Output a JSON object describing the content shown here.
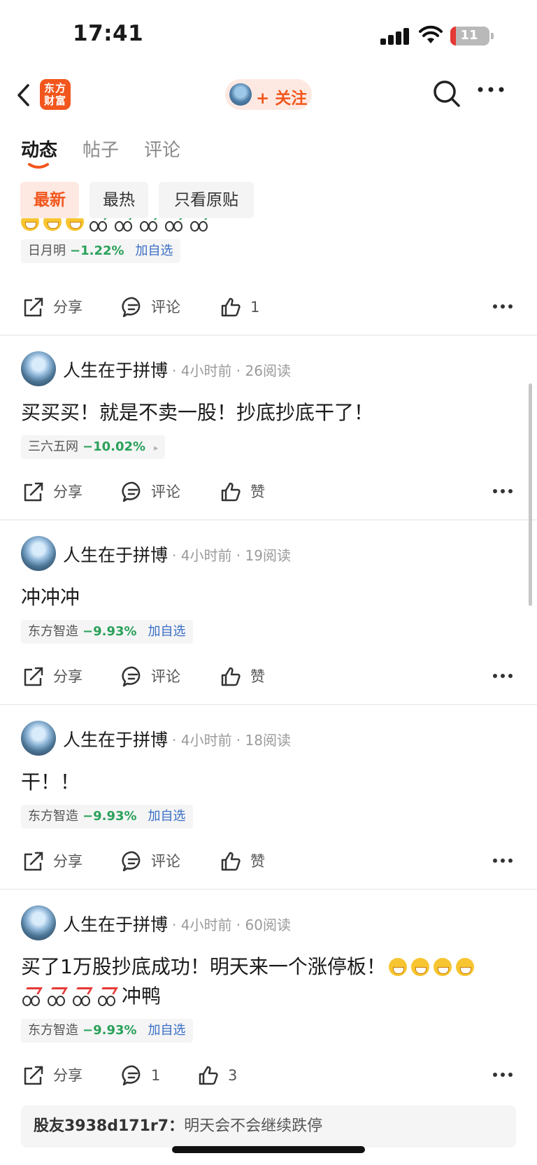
{
  "status_bar": {
    "time": "17:41",
    "battery": "11"
  },
  "header": {
    "logo_line1": "东方",
    "logo_line2": "财富",
    "follow_label": "+ 关注"
  },
  "tabs": [
    {
      "label": "动态",
      "active": true
    },
    {
      "label": "帖子",
      "active": false
    },
    {
      "label": "评论",
      "active": false
    }
  ],
  "filters": [
    {
      "label": "最新",
      "active": true
    },
    {
      "label": "最热",
      "active": false
    },
    {
      "label": "只看原贴",
      "active": false
    }
  ],
  "top_post": {
    "stock": {
      "name": "日月明",
      "change": "−1.22%",
      "action": "加自选"
    },
    "actions": {
      "share": "分享",
      "comment": "评论",
      "like": "1"
    }
  },
  "posts": [
    {
      "author": "人生在于拼博",
      "time": "4小时前",
      "reads": "26阅读",
      "content": "买买买！就是不卖一股！抄底抄底干了！",
      "stock": {
        "name": "三六五网",
        "change": "−10.02%",
        "action": "▸"
      },
      "actions": {
        "share": "分享",
        "comment": "评论",
        "like": "赞"
      }
    },
    {
      "author": "人生在于拼博",
      "time": "4小时前",
      "reads": "19阅读",
      "content": "冲冲冲",
      "stock": {
        "name": "东方智造",
        "change": "−9.93%",
        "action": "加自选"
      },
      "actions": {
        "share": "分享",
        "comment": "评论",
        "like": "赞"
      }
    },
    {
      "author": "人生在于拼博",
      "time": "4小时前",
      "reads": "18阅读",
      "content": "干！！",
      "stock": {
        "name": "东方智造",
        "change": "−9.93%",
        "action": "加自选"
      },
      "actions": {
        "share": "分享",
        "comment": "评论",
        "like": "赞"
      }
    },
    {
      "author": "人生在于拼博",
      "time": "4小时前",
      "reads": "60阅读",
      "content_line1": "买了1万股抄底成功！明天来一个涨停板！",
      "content_line2_suffix": "冲鸭",
      "stock": {
        "name": "东方智造",
        "change": "−9.93%",
        "action": "加自选"
      },
      "actions": {
        "share": "分享",
        "comment": "1",
        "like": "3"
      },
      "reply": {
        "user": "股友3938d171r7：",
        "text": "明天会不会继续跌停"
      }
    }
  ],
  "colors": {
    "accent": "#f2561d",
    "down": "#2aa15a",
    "link": "#3a6fc6"
  }
}
